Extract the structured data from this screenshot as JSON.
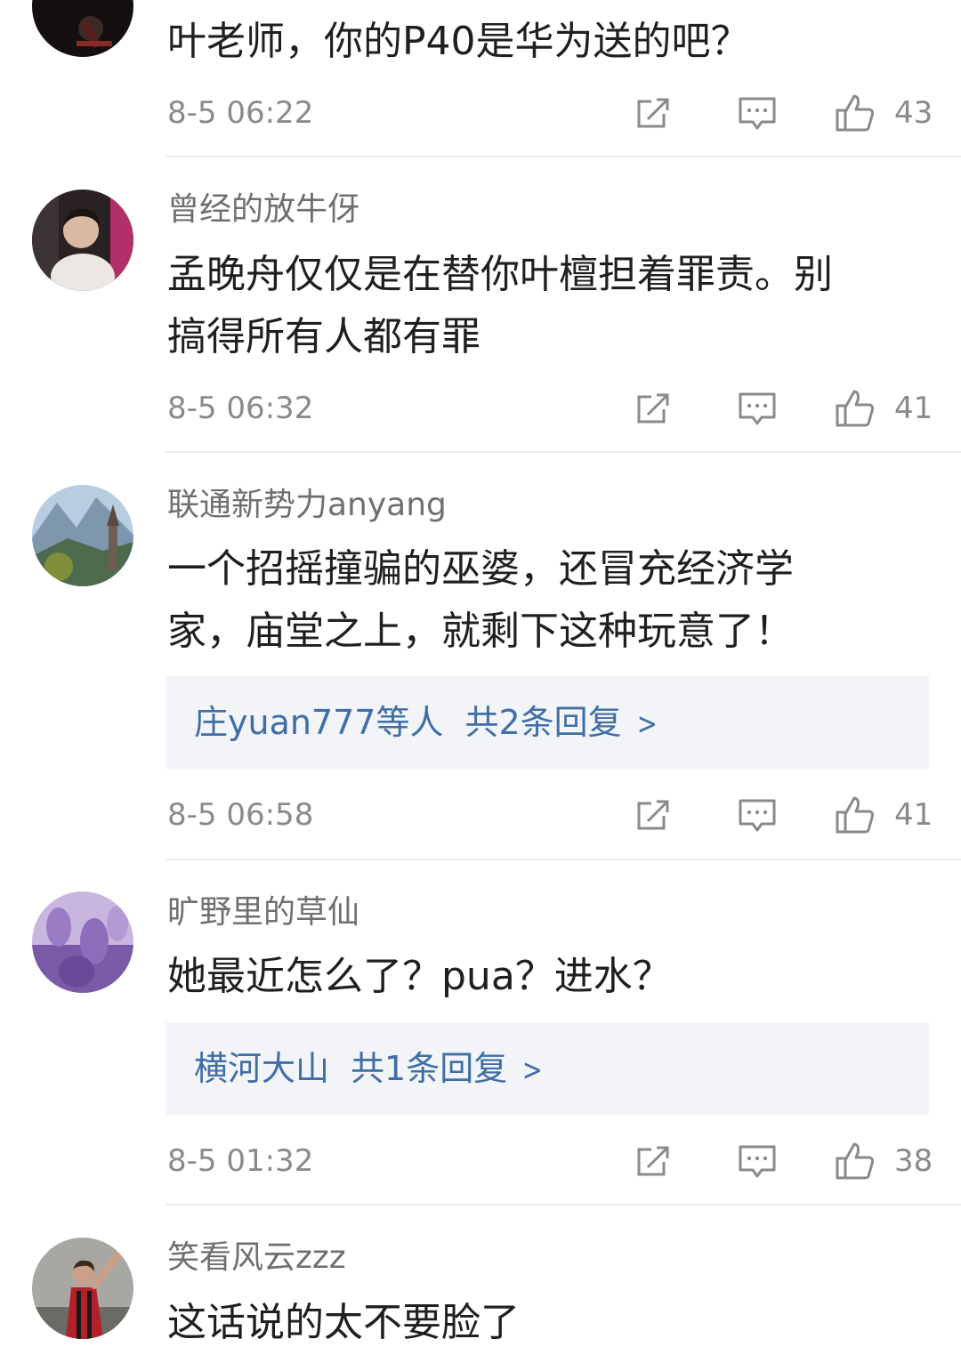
{
  "comments": [
    {
      "username": "",
      "lines": [
        "叶老师，你的P40是华为送的吧？"
      ],
      "time": "8-5 06:22",
      "likes": "43"
    },
    {
      "username": "曾经的放牛伢",
      "lines": [
        "孟晚舟仅仅是在替你叶檀担着罪责。别",
        "搞得所有人都有罪"
      ],
      "time": "8-5 06:32",
      "likes": "41"
    },
    {
      "username": "联通新势力anyang",
      "lines": [
        "一个招摇撞骗的巫婆，还冒充经济学",
        "家，庙堂之上，就剩下这种玩意了！"
      ],
      "replies": {
        "who": "庄yuan777等人",
        "count": "共2条回复"
      },
      "time": "8-5 06:58",
      "likes": "41"
    },
    {
      "username": "旷野里的草仙",
      "lines": [
        "她最近怎么了？pua？进水？"
      ],
      "replies": {
        "who": "横河大山",
        "count": "共1条回复"
      },
      "time": "8-5 01:32",
      "likes": "38"
    },
    {
      "username": "笑看风云zzz",
      "lines": [
        "这话说的太不要脸了"
      ]
    }
  ],
  "icons": {
    "share": "share-icon",
    "reply": "comment-icon",
    "like": "thumbs-up-icon"
  },
  "colors": {
    "reply_link": "#3f6ea7",
    "meta_gray": "#8a8a8a",
    "reply_box_bg": "#f3f4f7"
  }
}
